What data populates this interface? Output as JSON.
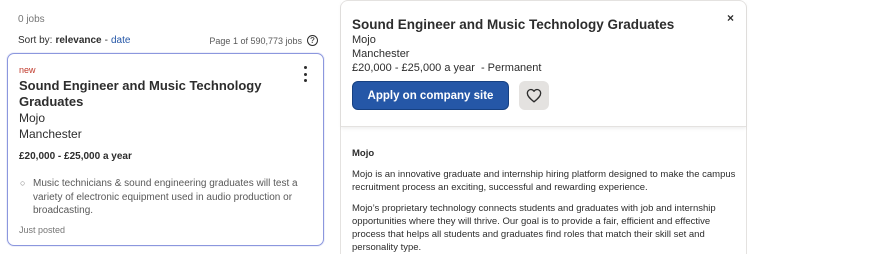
{
  "results": {
    "jobs_count": "0 jobs",
    "sort_label": "Sort by:",
    "sort_active": "relevance",
    "sort_separator": "-",
    "sort_alternate": "date",
    "page_info": "Page 1 of 590,773 jobs",
    "help_icon": "?"
  },
  "job_card": {
    "badge": "new",
    "title": "Sound Engineer and Music Technology Graduates",
    "company": "Mojo",
    "location": "Manchester",
    "salary": "£20,000 - £25,000 a year",
    "snippet": "Music technicians & sound engineering graduates will test a variety of electronic equipment used in audio production or broadcasting.",
    "posted": "Just posted",
    "bullet": "○"
  },
  "detail_panel": {
    "title": "Sound Engineer and Music Technology Graduates",
    "close_glyph": "×",
    "company": "Mojo",
    "location": "Manchester",
    "salary": "£20,000 - £25,000 a year",
    "job_type": "- Permanent",
    "apply_label": "Apply on company site",
    "section_title": "Mojo",
    "paragraphs": [
      "Mojo is an innovative graduate and internship hiring platform designed to make the campus recruitment process an exciting, successful and rewarding experience.",
      "Mojo’s proprietary technology connects students and graduates with job and internship opportunities where they will thrive. Our goal is to provide a fair, efficient and effective process that helps all students and graduates find roles that match their skill set and personality type."
    ]
  },
  "colors": {
    "accent": "#2557a7",
    "card_border": "#8c97de",
    "new_badge": "#c0392b"
  },
  "icons": {
    "kebab": "kebab-menu-icon",
    "heart": "heart-icon",
    "close": "close-icon",
    "help": "help-circle-icon"
  }
}
